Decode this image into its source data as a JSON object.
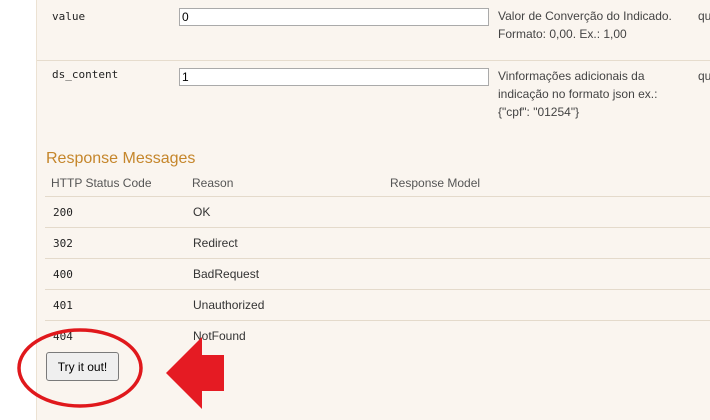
{
  "parameters": [
    {
      "name": "value",
      "input_value": "0",
      "description": "Valor de Converção do Indicado. Formato: 0,00. Ex.: 1,00",
      "description_lines": [
        "Valor de Converção do Indicado.",
        "Formato: 0,00. Ex.: 1,00"
      ],
      "type_fragment": "qu"
    },
    {
      "name": "ds_content",
      "input_value": "1",
      "description_lines": [
        "Vinformações adicionais da",
        "indicação no formato json ex.:",
        "{\"cpf\": \"01254\"}"
      ],
      "type_fragment": "qu"
    }
  ],
  "response_messages": {
    "title": "Response Messages",
    "headers": {
      "code": "HTTP Status Code",
      "reason": "Reason",
      "model": "Response Model"
    },
    "rows": [
      {
        "code": "200",
        "reason": "OK"
      },
      {
        "code": "302",
        "reason": "Redirect"
      },
      {
        "code": "400",
        "reason": "BadRequest"
      },
      {
        "code": "401",
        "reason": "Unauthorized"
      },
      {
        "code": "404",
        "reason": "NotFound"
      }
    ]
  },
  "try_button": {
    "label": "Try it out!"
  },
  "annotation": {
    "circle_color": "#e0181c",
    "arrow_color": "#e51b23",
    "arrow_direction": "left"
  },
  "colors": {
    "panel_background": "#faf5ef",
    "section_title": "#c5862b"
  }
}
